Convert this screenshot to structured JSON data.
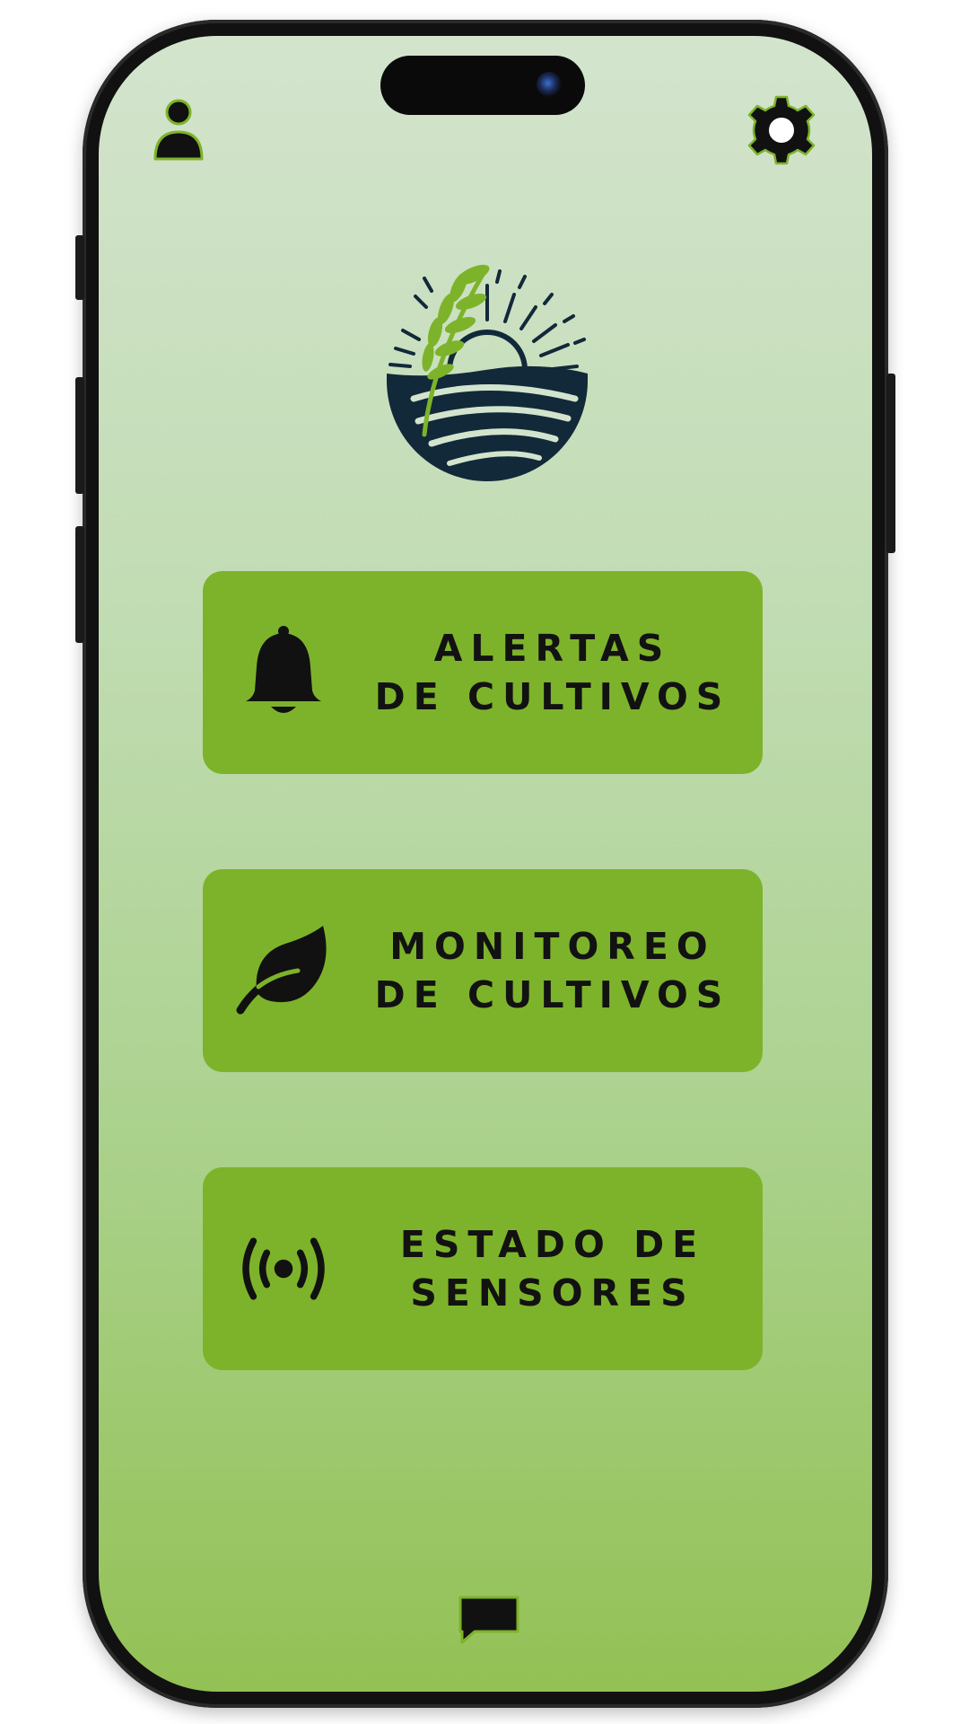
{
  "app": {
    "colors": {
      "card_background": "#7db32a",
      "screen_top": "#d3e4cd",
      "screen_bottom": "#93c154",
      "icon_dark": "#111111",
      "accent_green": "#7db32a"
    }
  },
  "header": {
    "left_icon": "user-icon",
    "right_icon": "gear-icon"
  },
  "logo": {
    "icon": "farm-sunrise-logo"
  },
  "menu": {
    "items": [
      {
        "icon": "bell-icon",
        "line1": "ALERTAS",
        "line2": "DE CULTIVOS"
      },
      {
        "icon": "leaf-icon",
        "line1": "MONITOREO",
        "line2": "DE CULTIVOS"
      },
      {
        "icon": "broadcast-icon",
        "line1": "ESTADO DE",
        "line2": "SENSORES"
      }
    ]
  },
  "footer": {
    "icon": "chat-icon"
  }
}
